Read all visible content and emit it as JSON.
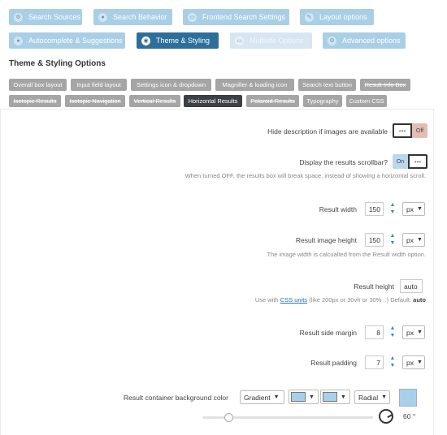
{
  "tabs": [
    {
      "label": "Search Sources",
      "icon": "gear-icon",
      "glyph": "⚙"
    },
    {
      "label": "Search Behavior",
      "icon": "pin-icon",
      "glyph": "●"
    },
    {
      "label": "Frontend Search Settings",
      "icon": "window-icon",
      "glyph": "▭"
    },
    {
      "label": "Layout options",
      "icon": "pencil-icon",
      "glyph": "✎"
    },
    {
      "label": "Autocomplete & Suggestions",
      "icon": "pin-icon",
      "glyph": "●"
    },
    {
      "label": "Theme & Styling",
      "icon": "eye-icon",
      "glyph": "◉"
    },
    {
      "label": "Multisite Options",
      "icon": "window-icon",
      "glyph": "▭"
    },
    {
      "label": "Advanced options",
      "icon": "gears-icon",
      "glyph": "⚙"
    }
  ],
  "section_title": "Theme & Styling Options",
  "subtabs": [
    "Overall box layout",
    "Input field layout",
    "Settings icon & dropdown",
    "Magnifier & loading icon",
    "Search text button",
    "Result Info Box",
    "Isotopic Results",
    "Isotopic Navigation",
    "Vertical Results",
    "Horizontal Results",
    "Polaroid Results",
    "Typography",
    "Custom CSS"
  ],
  "options": {
    "hide_desc_label": "Hide description if images are available",
    "hide_desc_toggle": "Off",
    "toggle_dots": "•••",
    "scrollbar_label": "Display the results scrollbar?",
    "scrollbar_toggle": "On",
    "scrollbar_desc": "When turned OFF, the results box will break space, instead of showing a horizontal scroll.",
    "result_width_label": "Result width",
    "result_width_value": "150",
    "result_width_unit": "px",
    "image_height_label": "Result image height",
    "image_height_value": "150",
    "image_height_unit": "px",
    "image_height_desc": "The image width is calcualted from the Result width option.",
    "result_height_label": "Result height",
    "result_height_value": "auto",
    "result_height_desc_prefix": "Use with",
    "result_height_desc_link": "CSS units",
    "result_height_desc_suffix": "(like 200px or 30vh or 30% ..) Default:",
    "result_height_desc_default": "auto",
    "side_margin_label": "Result side margin",
    "side_margin_value": "8",
    "side_margin_unit": "px",
    "padding_label": "Result padding",
    "padding_value": "7",
    "padding_unit": "px",
    "bg_label": "Result container background color",
    "bg_type": "Gradient",
    "bg_shape": "Radial",
    "bg_color": "#a8d0ea",
    "angle_value": "60",
    "angle_unit": "°",
    "slider_fraction": 0.15
  }
}
